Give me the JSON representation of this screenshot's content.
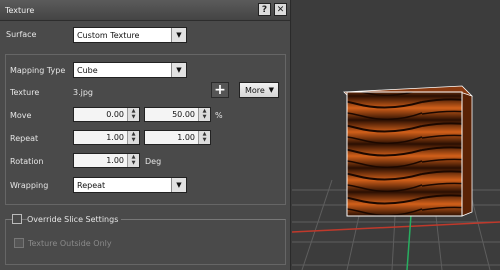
{
  "window": {
    "title": "Texture",
    "help_label": "?",
    "close_label": "✕"
  },
  "surface": {
    "label": "Surface",
    "value": "Custom Texture"
  },
  "mapping": {
    "label": "Mapping Type",
    "value": "Cube"
  },
  "texture": {
    "label": "Texture",
    "file": "3.jpg",
    "add_label": "+",
    "more_label": "More"
  },
  "move": {
    "label": "Move",
    "x": "0.00",
    "y": "50.00",
    "unit": "%"
  },
  "repeat": {
    "label": "Repeat",
    "x": "1.00",
    "y": "1.00"
  },
  "rotation": {
    "label": "Rotation",
    "value": "1.00",
    "unit": "Deg"
  },
  "wrapping": {
    "label": "Wrapping",
    "value": "Repeat"
  },
  "override": {
    "label": "Override Slice Settings",
    "checked": false
  },
  "texture_outside": {
    "label": "Texture Outside Only",
    "checked": false,
    "enabled": false
  },
  "colors": {
    "panel": "#4a4a4a",
    "viewport": "#3c3c3c",
    "grid": "#6a6a6a",
    "axis_red": "#c0392b",
    "axis_green": "#27ae60",
    "wood_dark": "#2a0f02",
    "wood_light": "#d2601a"
  }
}
